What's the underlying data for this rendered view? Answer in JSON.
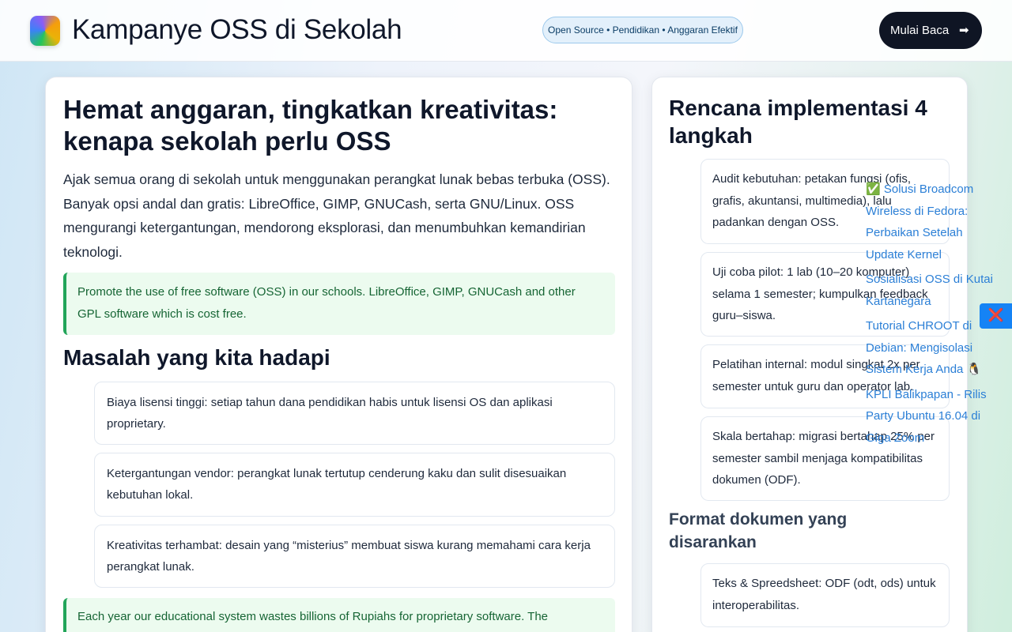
{
  "header": {
    "title": "Kampanye OSS di Sekolah",
    "tagline": "Open Source • Pendidikan • Anggaran Efektif",
    "cta_label": "Mulai Baca",
    "cta_arrow": "➡"
  },
  "article": {
    "title": "Hemat anggaran, tingkatkan kreativitas: kenapa sekolah perlu OSS",
    "intro": "Ajak semua orang di sekolah untuk menggunakan perangkat lunak bebas terbuka (OSS). Banyak opsi andal dan gratis: LibreOffice, GIMP, GNUCash, serta GNU/Linux. OSS mengurangi ketergantungan, mendorong eksplorasi, dan menumbuhkan kemandirian teknologi.",
    "quote1": "Promote the use of free software (OSS) in our schools. LibreOffice, GIMP, GNUCash and other GPL software which is cost free.",
    "problems_heading": "Masalah yang kita hadapi",
    "problems": [
      "Biaya lisensi tinggi: setiap tahun dana pendidikan habis untuk lisensi OS dan aplikasi proprietary.",
      "Ketergantungan vendor: perangkat lunak tertutup cenderung kaku dan sulit disesuaikan kebutuhan lokal.",
      "Kreativitas terhambat: desain yang “misterius” membuat siswa kurang memahami cara kerja perangkat lunak."
    ],
    "quote2": "Each year our educational system wastes billions of Rupiahs for proprietary software. The"
  },
  "sidebar": {
    "plan_heading": "Rencana implementasi 4 langkah",
    "steps": [
      "Audit kebutuhan: petakan fungsi (ofis, grafis, akuntansi, multimedia), lalu padankan dengan OSS.",
      "Uji coba pilot: 1 lab (10–20 komputer) selama 1 semester; kumpulkan feedback guru–siswa.",
      "Pelatihan internal: modul singkat 2x per semester untuk guru dan operator lab.",
      "Skala bertahap: migrasi bertahap 25% per semester sambil menjaga kompatibilitas dokumen (ODF)."
    ],
    "format_heading": "Format dokumen yang disarankan",
    "formats": [
      "Teks & Spreedsheet: ODF (odt, ods) untuk interoperabilitas."
    ]
  },
  "overlay_links": [
    "✅ Solusi Broadcom Wireless di Fedora: Perbaikan Setelah Update Kernel",
    "Sosialisasi OSS di Kutai Kartanegara",
    "Tutorial CHROOT di Debian: Mengisolasi Sistem Kerja Anda 🐧",
    "KPLI Balikpapan - Rilis Party Ubuntu 16.04 di Giga Zoom"
  ],
  "overlay_close": "❌"
}
